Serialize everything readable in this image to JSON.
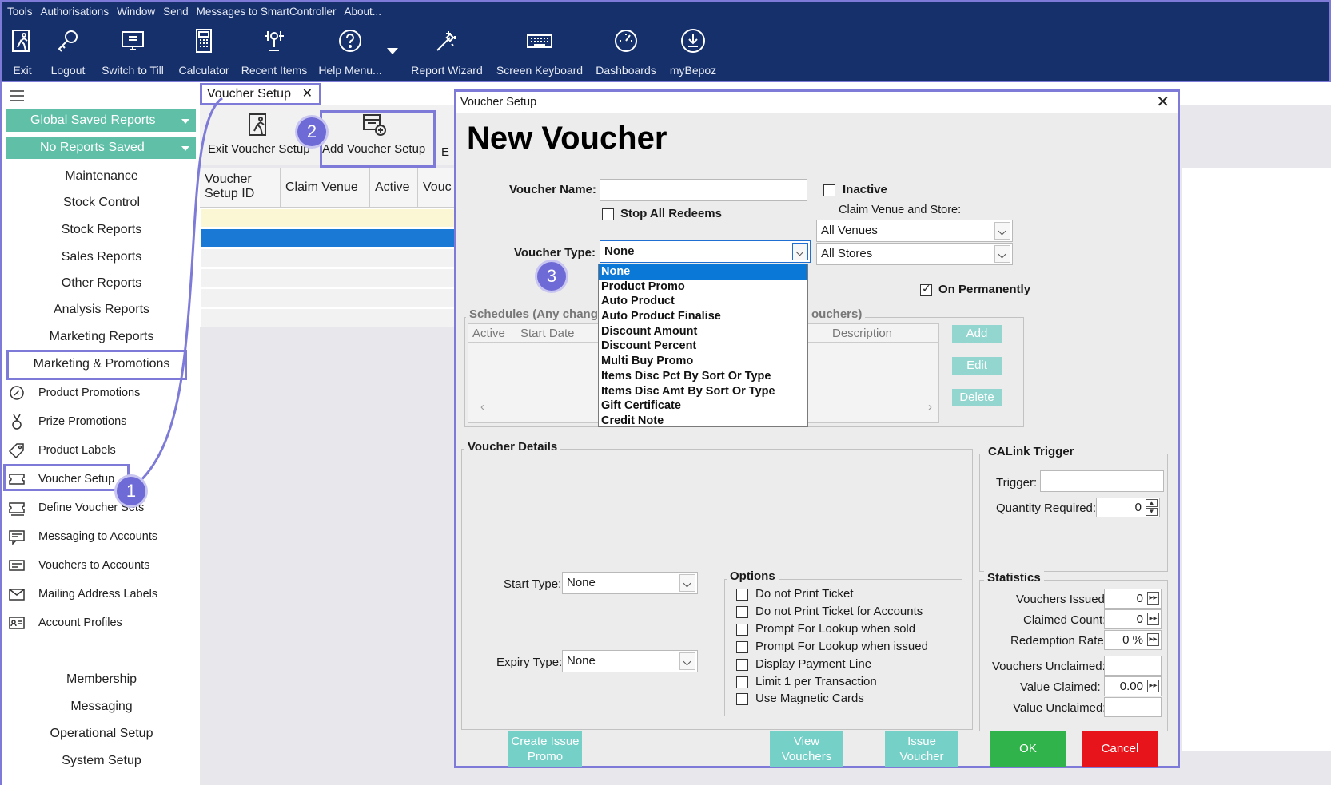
{
  "menu": [
    "Tools",
    "Authorisations",
    "Window",
    "Send",
    "Messages to SmartController",
    "About..."
  ],
  "toolbar": {
    "exit": "Exit",
    "logout": "Logout",
    "switch_to_till": "Switch to Till",
    "calculator": "Calculator",
    "recent_items": "Recent Items",
    "help_menu": "Help Menu...",
    "report_wizard": "Report Wizard",
    "screen_keyboard": "Screen Keyboard",
    "dashboards": "Dashboards",
    "mybepoz": "myBepoz"
  },
  "sidebar": {
    "global_saved_reports": "Global Saved Reports",
    "no_reports_saved": "No Reports Saved",
    "sections": [
      "Maintenance",
      "Stock Control",
      "Stock Reports",
      "Sales Reports",
      "Other Reports",
      "Analysis Reports",
      "Marketing Reports",
      "Marketing & Promotions"
    ],
    "items": [
      "Product Promotions",
      "Prize Promotions",
      "Product Labels",
      "Voucher Setup",
      "Define Voucher Sets",
      "Messaging to Accounts",
      "Vouchers to Accounts",
      "Mailing Address Labels",
      "Account Profiles"
    ],
    "bottom": [
      "Membership",
      "Messaging",
      "Operational Setup",
      "System Setup"
    ]
  },
  "tab": {
    "label": "Voucher Setup",
    "close": "✕"
  },
  "main_toolbar": {
    "exit_voucher_setup": "Exit Voucher Setup",
    "add_voucher_setup": "Add Voucher Setup",
    "partial": "E"
  },
  "grid": {
    "col1a": "Voucher",
    "col1b": "Setup ID",
    "col2": "Claim Venue",
    "col3": "Active",
    "col4": "Vouc"
  },
  "badges": [
    "1",
    "2",
    "3"
  ],
  "dialog": {
    "title": "Voucher Setup",
    "close": "✕",
    "heading": "New Voucher",
    "voucher_name_label": "Voucher Name:",
    "voucher_name_value": "",
    "inactive_label": "Inactive",
    "stop_all_redeems_label": "Stop All Redeems",
    "claim_venue_label": "Claim Venue and Store:",
    "venue_value": "All Venues",
    "store_value": "All Stores",
    "voucher_type_label": "Voucher Type:",
    "voucher_type_value": "None",
    "voucher_type_options": [
      "None",
      "Product Promo",
      "Auto Product",
      "Auto Product Finalise",
      "Discount Amount",
      "Discount Percent",
      "Multi Buy Promo",
      "Items Disc Pct By Sort Or Type",
      "Items Disc Amt By Sort Or Type",
      "Gift Certificate",
      "Credit Note"
    ],
    "on_permanently_label": "On Permanently",
    "schedules_legend_a": "Schedules (Any changes",
    "schedules_legend_b": "ouchers)",
    "sched_col_active": "Active",
    "sched_col_start": "Start Date",
    "sched_col_desc": "Description",
    "sched_add": "Add",
    "sched_edit": "Edit",
    "sched_delete": "Delete",
    "voucher_details_legend": "Voucher Details",
    "start_type_label": "Start Type:",
    "start_type_value": "None",
    "expiry_type_label": "Expiry Type:",
    "expiry_type_value": "None",
    "options_legend": "Options",
    "options": [
      "Do not Print Ticket",
      "Do not Print Ticket for Accounts",
      "Prompt For Lookup when sold",
      "Prompt For Lookup when issued",
      "Display Payment Line",
      "Limit 1 per Transaction",
      "Use Magnetic Cards"
    ],
    "calink_legend": "CALink Trigger",
    "trigger_label": "Trigger:",
    "quantity_required_label": "Quantity Required:",
    "quantity_required_value": "0",
    "statistics_legend": "Statistics",
    "vouchers_issued_label": "Vouchers Issued:",
    "vouchers_issued_value": "0",
    "claimed_count_label": "Claimed Count:",
    "claimed_count_value": "0",
    "redemption_rate_label": "Redemption Rate:",
    "redemption_rate_value": "0 %",
    "vouchers_unclaimed_label": "Vouchers Unclaimed:",
    "value_claimed_label": "Value Claimed:",
    "value_claimed_value": "0.00",
    "value_unclaimed_label": "Value Unclaimed:",
    "create_issue_promo_a": "Create Issue",
    "create_issue_promo_b": "Promo",
    "view_vouchers_a": "View",
    "view_vouchers_b": "Vouchers",
    "issue_voucher_a": "Issue",
    "issue_voucher_b": "Voucher",
    "ok": "OK",
    "cancel": "Cancel"
  },
  "colors": {
    "navy": "#16306b",
    "teal": "#5fbfa7",
    "highlight": "#7d7ad8",
    "ok": "#2fb34a",
    "cancel": "#e8141b",
    "select": "#0a78d7"
  }
}
